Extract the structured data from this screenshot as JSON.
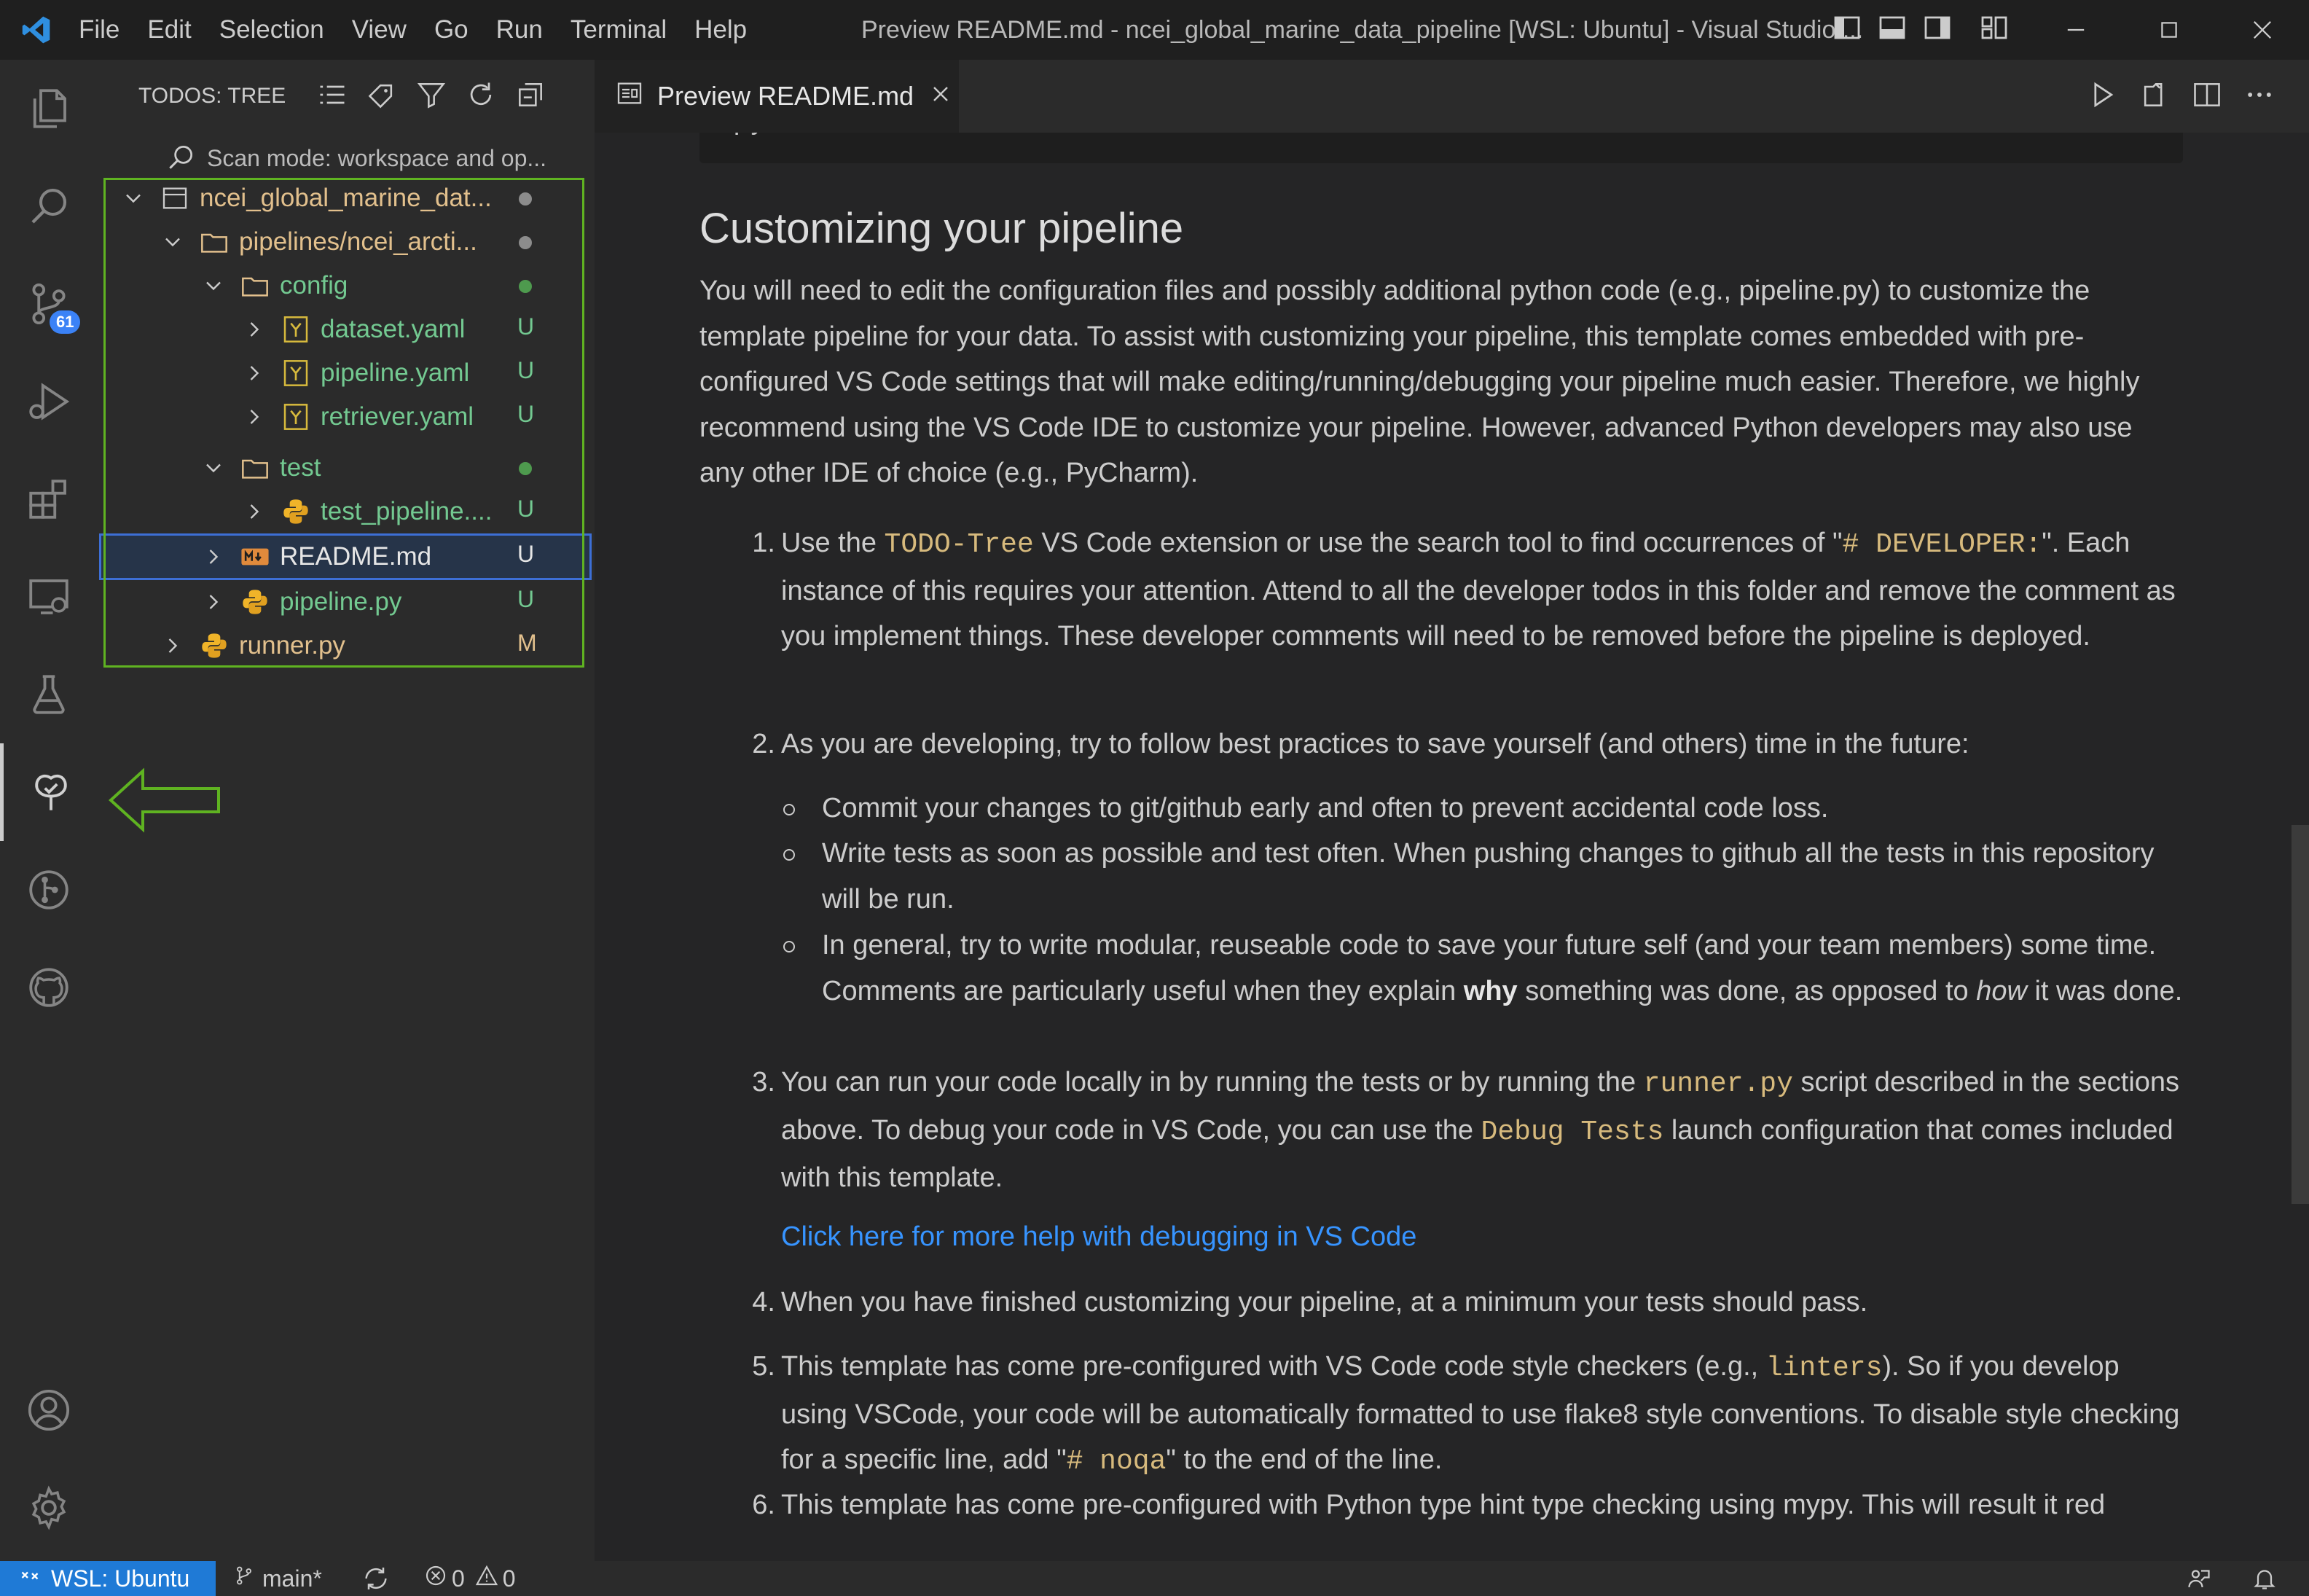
{
  "app": {
    "window_title": "Preview README.md - ncei_global_marine_data_pipeline [WSL: Ubuntu] - Visual Studio ...",
    "menu": [
      "File",
      "Edit",
      "Selection",
      "View",
      "Go",
      "Run",
      "Terminal",
      "Help"
    ]
  },
  "activitybar": {
    "scm_badge": "61",
    "icons": [
      "explorer-icon",
      "search-icon",
      "source-control-icon",
      "run-debug-icon",
      "extensions-icon",
      "remote-explorer-icon",
      "testing-icon",
      "todo-tree-icon",
      "git-graph-icon",
      "github-icon",
      "accounts-icon",
      "settings-gear-icon"
    ]
  },
  "sidebar": {
    "title": "TODOS: TREE",
    "scan_mode": "Scan mode: workspace and op...",
    "tree": [
      {
        "label": "ncei_global_marine_dat...",
        "status": "",
        "dot": "#8c8c8c"
      },
      {
        "label": "pipelines/ncei_arcti...",
        "status": "",
        "dot": "#8c8c8c"
      },
      {
        "label": "config",
        "status": "",
        "dot": "#4e9a4e"
      },
      {
        "label": "dataset.yaml",
        "status": "U"
      },
      {
        "label": "pipeline.yaml",
        "status": "U"
      },
      {
        "label": "retriever.yaml",
        "status": "U"
      },
      {
        "label": "test",
        "status": "",
        "dot": "#4e9a4e"
      },
      {
        "label": "test_pipeline....",
        "status": "U"
      },
      {
        "label": "README.md",
        "status": "U"
      },
      {
        "label": "pipeline.py",
        "status": "U"
      },
      {
        "label": "runner.py",
        "status": "M"
      }
    ]
  },
  "editor": {
    "tab_label": "Preview README.md",
    "code_tail": "pytest",
    "heading": "Customizing your pipeline",
    "intro": "You will need to edit the configuration files and possibly additional python code (e.g., pipeline.py) to customize the template pipeline for your data. To assist with customizing your pipeline, this template comes embedded with pre-configured VS Code settings that will make editing/running/debugging your pipeline much easier. Therefore, we highly recommend using the VS Code IDE to customize your pipeline. However, advanced Python developers may also use any other IDE of choice (e.g., PyCharm).",
    "item1": {
      "num": "1.",
      "a": "Use the ",
      "code1": "TODO-Tree",
      "b": " VS Code extension or use the search tool to find occurrences of \"",
      "code2": "# DEVELOPER:",
      "c": "\". Each instance of this requires your attention. Attend to all the developer todos in this folder and remove the comment as you implement things. These developer comments will need to be removed before the pipeline is deployed."
    },
    "item2": {
      "num": "2.",
      "text": "As you are developing, try to follow best practices to save yourself (and others) time in the future:",
      "sub1": "Commit your changes to git/github early and often to prevent accidental code loss.",
      "sub2": "Write tests as soon as possible and test often. When pushing changes to github all the tests in this repository will be run.",
      "sub3a": "In general, try to write modular, reuseable code to save your future self (and your team members) some time. Comments are particularly useful when they explain ",
      "sub3_bold": "why",
      "sub3b": " something was done, as opposed to ",
      "sub3_italic": "how",
      "sub3c": " it was done."
    },
    "item3": {
      "num": "3.",
      "a": "You can run your code locally in by running the tests or by running the ",
      "code1": "runner.py",
      "b": " script described in the sections above. To debug your code in VS Code, you can use the ",
      "code2": "Debug Tests",
      "c": " launch configuration that comes included with this template.",
      "link": "Click here for more help with debugging in VS Code"
    },
    "item4": {
      "num": "4.",
      "text": "When you have finished customizing your pipeline, at a minimum your tests should pass."
    },
    "item5": {
      "num": "5.",
      "a": "This template has come pre-configured with VS Code code style checkers (e.g., ",
      "code1": "linters",
      "b": "). So if you develop using VSCode, your code will be automatically formatted to use flake8 style conventions. To disable style checking for a specific line, add \"",
      "code2": "# noqa",
      "c": "\" to the end of the line."
    },
    "item6": {
      "num": "6.",
      "text": "This template has come pre-configured with Python type hint type checking using mypy. This will result it red"
    }
  },
  "statusbar": {
    "remote": "WSL: Ubuntu",
    "branch": "main*",
    "errors": "0",
    "warnings": "0"
  },
  "colors": {
    "accent_blue": "#1f7ad6",
    "git_untracked": "#73c991",
    "git_modified": "#e2c08d",
    "highlight_green": "#5fb321"
  }
}
